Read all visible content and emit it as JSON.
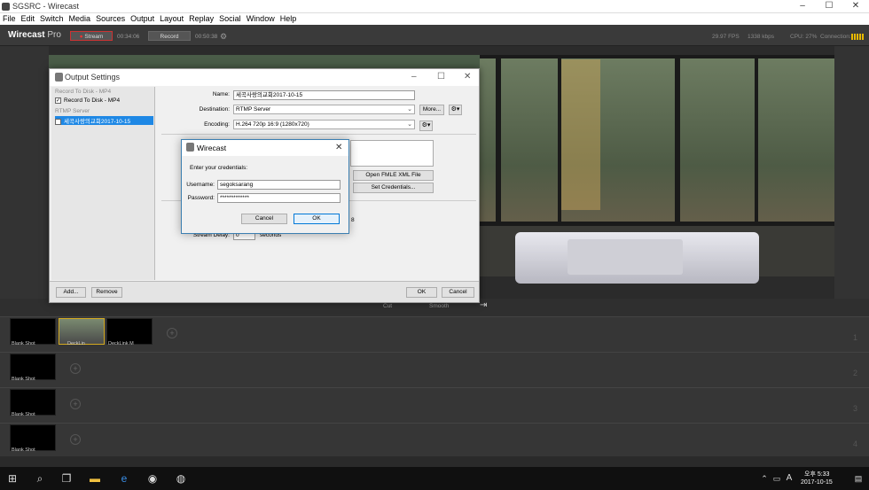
{
  "window": {
    "title": "SGSRC - Wirecast",
    "minimize": "–",
    "maximize": "☐",
    "close": "✕"
  },
  "menu": [
    "File",
    "Edit",
    "Switch",
    "Media",
    "Sources",
    "Output",
    "Layout",
    "Replay",
    "Social",
    "Window",
    "Help"
  ],
  "toolbar": {
    "logo": "Wirecast",
    "logo_suffix": "Pro",
    "stream_label": "Stream",
    "stream_time": "00:34:06",
    "record_label": "Record",
    "record_time": "00:50:38",
    "fps": "29.97 FPS",
    "kbps": "1338 kbps",
    "cpu": "CPU: 27%",
    "connection": "Connection:"
  },
  "transition": {
    "cut": "Cut",
    "smooth": "Smooth"
  },
  "output_settings": {
    "title": "Output Settings",
    "sidebar": {
      "group1": "Record To Disk - MP4",
      "item1": "Record To Disk - MP4",
      "group2": "RTMP Server",
      "item2": "세곡사랑의교회2017-10-15"
    },
    "name_label": "Name:",
    "name_value": "세곡사랑의교회2017-10-15",
    "destination_label": "Destination:",
    "destination_value": "RTMP Server",
    "more_button": "More...",
    "encoding_label": "Encoding:",
    "encoding_value": "H.264 720p 16:9 (1280x720)",
    "open_fmle_button": "Open FMLE XML File",
    "set_credentials_button": "Set Credentials...",
    "partial_text": "8",
    "stream_delay_label": "Stream Delay:",
    "stream_delay_value": "0",
    "stream_delay_unit": "seconds",
    "add_button": "Add...",
    "remove_button": "Remove",
    "ok_button": "OK",
    "cancel_button": "Cancel"
  },
  "credentials_dialog": {
    "title": "Wirecast",
    "prompt": "Enter your credentials:",
    "username_label": "Username:",
    "username_value": "segoksarang",
    "password_label": "Password:",
    "password_value": "*************",
    "cancel_button": "Cancel",
    "ok_button": "OK"
  },
  "shots": {
    "blank1": "Blank Shot",
    "decklink1": "DeckLin",
    "decklink2": "DeckLink M",
    "blank2": "Blank Shot",
    "blank3": "Blank Shot",
    "blank4": "Blank Shot",
    "layer_numbers": [
      "1",
      "2",
      "3",
      "4"
    ]
  },
  "taskbar": {
    "time": "오후 5:33",
    "date": "2017-10-15",
    "ime": "A"
  }
}
